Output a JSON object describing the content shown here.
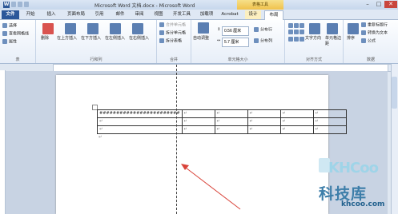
{
  "window": {
    "title": "Microsoft Word 文档.docx - Microsoft Word",
    "context_group": "表格工具"
  },
  "tabs": [
    "文件",
    "开始",
    "插入",
    "页面布局",
    "引用",
    "邮件",
    "审阅",
    "视图",
    "开发工具",
    "加载项",
    "Acrobat",
    "设计",
    "布局"
  ],
  "ribbon": {
    "table_group": {
      "items": [
        "选择",
        "查看网格线",
        "属性"
      ],
      "label": "表"
    },
    "delete_label": "删除",
    "insert_items": [
      "在上方插入",
      "在下方插入",
      "在左侧插入",
      "在右侧插入"
    ],
    "rows_cols_label": "行和列",
    "merge_items": [
      "合并单元格",
      "拆分单元格",
      "拆分表格"
    ],
    "merge_label": "合并",
    "autofit_label": "自动调整",
    "height_value": "0.56 厘米",
    "width_value": "5.7 厘米",
    "distribute_rows": "分布行",
    "distribute_cols": "分布列",
    "cell_size_label": "单元格大小",
    "text_direction": "文字方向",
    "cell_margins": "单元格边距",
    "alignment_label": "对齐方式",
    "sort": "排序",
    "repeat_header": "重复标题行",
    "convert_text": "转换为文本",
    "formula": "公式",
    "data_label": "数据"
  },
  "table": {
    "rows": [
      [
        "########################",
        "↵",
        "↵",
        "↵",
        "↵",
        "↵"
      ],
      [
        "↵",
        "↵",
        "↵",
        "↵",
        "↵",
        "↵"
      ],
      [
        "↵",
        "↵",
        "↵",
        "↵",
        "↵",
        "↵"
      ]
    ],
    "after_mark": "↵"
  },
  "watermark": {
    "brand": "KHCoo",
    "cn": "科技库",
    "url": "khcoo.com"
  }
}
